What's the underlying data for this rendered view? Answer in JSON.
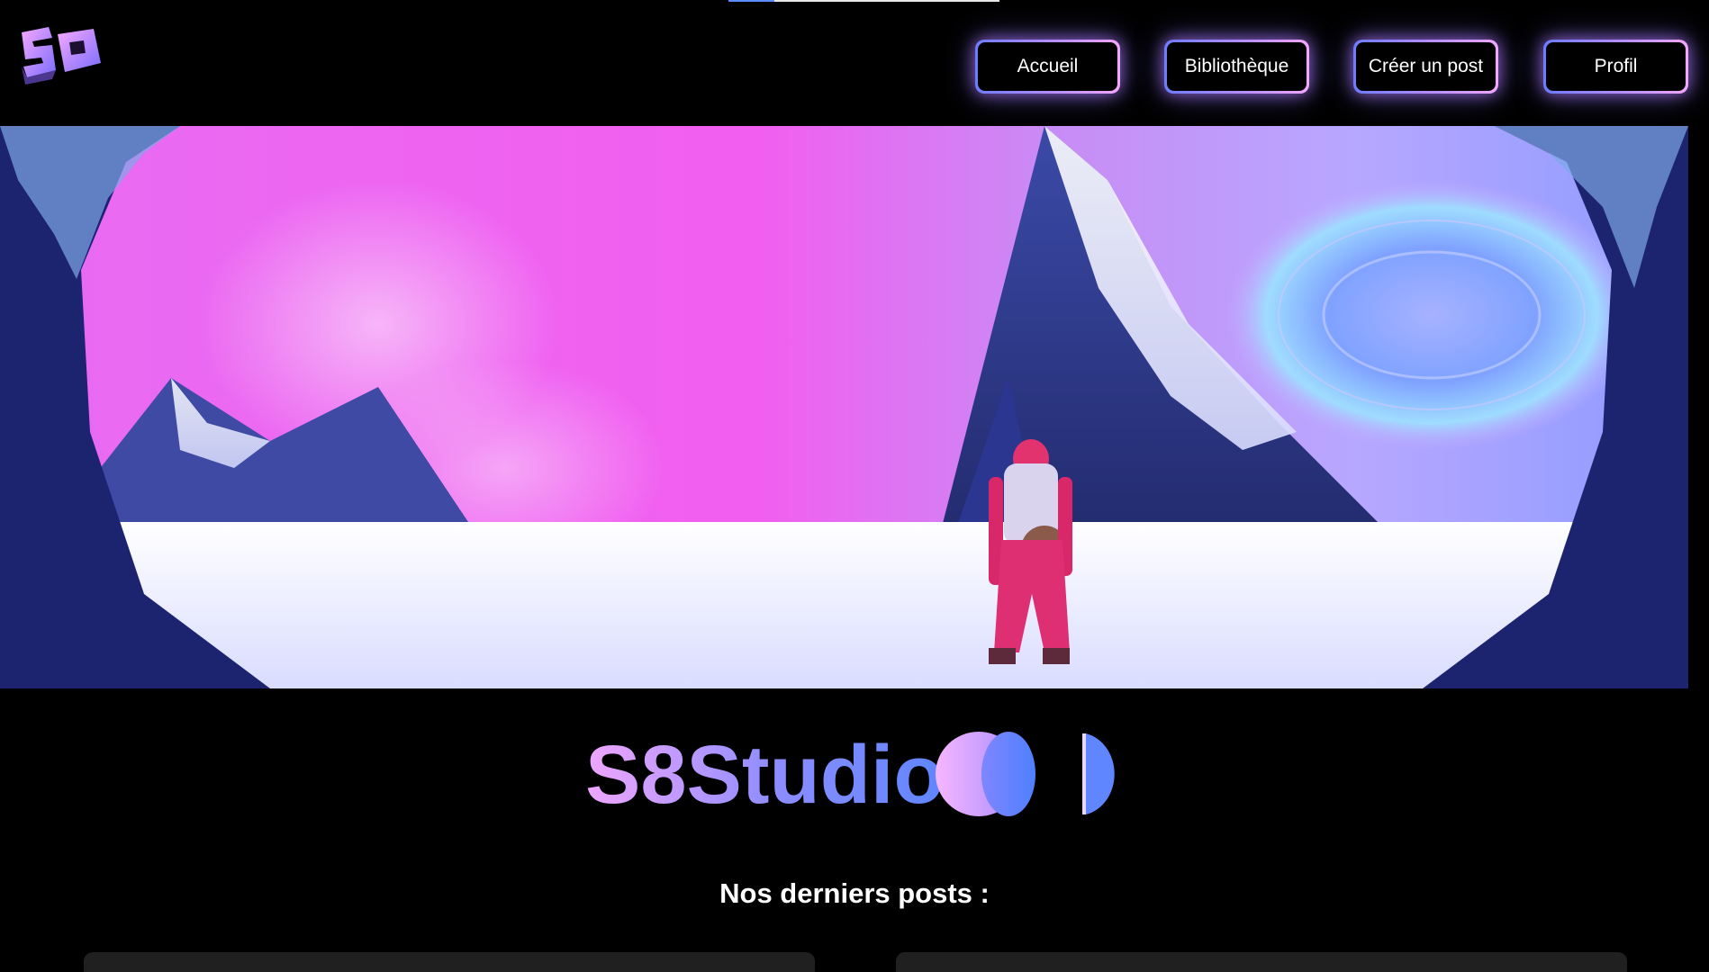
{
  "progress": {
    "fraction": 0.17,
    "fill_color": "#5b8cff"
  },
  "logo": {
    "text": "S8",
    "icon": "s8-logo-icon"
  },
  "nav": {
    "items": [
      {
        "label": "Accueil"
      },
      {
        "label": "Bibliothèque"
      },
      {
        "label": "Créer un post"
      },
      {
        "label": "Profil"
      }
    ]
  },
  "hero": {
    "icon": "mountain-hiker-banner-image"
  },
  "brand": {
    "name": "S8Studio",
    "icon": "s8studio-wordmark-logo"
  },
  "section": {
    "title": "Nos derniers posts :"
  },
  "posts": [
    {},
    {}
  ],
  "colors": {
    "accent_blue": "#6d7cff",
    "accent_violet": "#b08cff",
    "accent_pink": "#f3a7ff",
    "background": "#000000",
    "card": "#202020"
  }
}
